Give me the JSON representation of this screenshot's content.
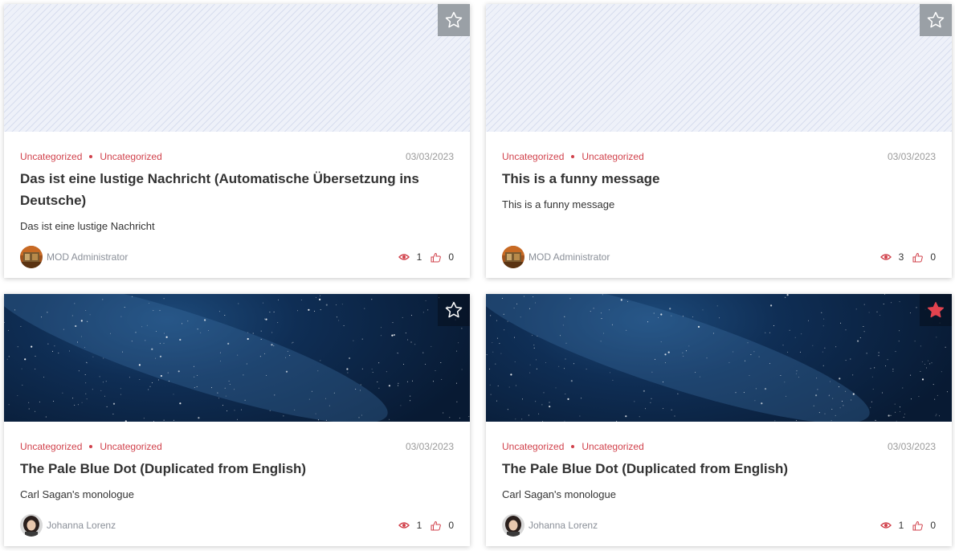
{
  "colors": {
    "accent": "#d1414b",
    "star_active": "#e2434f"
  },
  "cards": [
    {
      "categories": [
        "Uncategorized",
        "Uncategorized"
      ],
      "date": "03/03/2023",
      "title": "Das ist eine lustige Nachricht (Automatische Übersetzung ins Deutsche)",
      "excerpt": "Das ist eine lustige Nachricht",
      "author": "MOD Administrator",
      "views": "1",
      "likes": "0",
      "favorited": false,
      "image": "placeholder"
    },
    {
      "categories": [
        "Uncategorized",
        "Uncategorized"
      ],
      "date": "03/03/2023",
      "title": "This is a funny message",
      "excerpt": "This is a funny message",
      "author": "MOD Administrator",
      "views": "3",
      "likes": "0",
      "favorited": false,
      "image": "placeholder"
    },
    {
      "categories": [
        "Uncategorized",
        "Uncategorized"
      ],
      "date": "03/03/2023",
      "title": "The Pale Blue Dot (Duplicated from English)",
      "excerpt": "Carl Sagan's monologue",
      "author": "Johanna Lorenz",
      "views": "1",
      "likes": "0",
      "favorited": false,
      "image": "starry-sky"
    },
    {
      "categories": [
        "Uncategorized",
        "Uncategorized"
      ],
      "date": "03/03/2023",
      "title": "The Pale Blue Dot (Duplicated from English)",
      "excerpt": "Carl Sagan's monologue",
      "author": "Johanna Lorenz",
      "views": "1",
      "likes": "0",
      "favorited": true,
      "image": "starry-sky"
    }
  ]
}
